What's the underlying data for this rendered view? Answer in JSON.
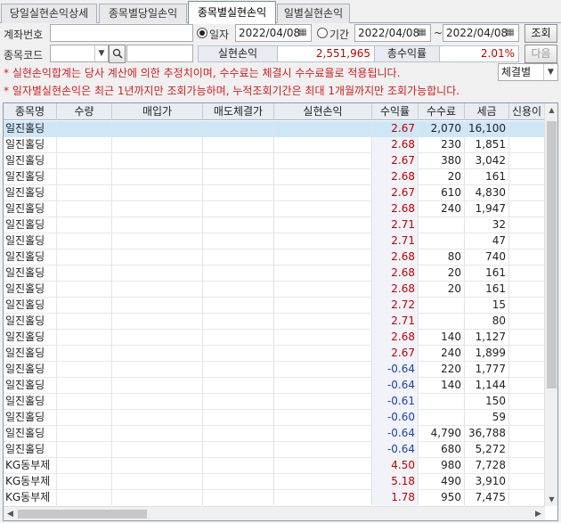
{
  "tabs": [
    "당일실현손익상세",
    "종목별당일손익",
    "종목별실현손익",
    "일별실현손익"
  ],
  "active_tab": 2,
  "form": {
    "account_label": "계좌번호",
    "code_label": "종목코드",
    "date_radio_label": "일자",
    "period_radio_label": "기간",
    "date_value": "2022/04/08",
    "period_from": "2022/04/08",
    "period_sep": "~",
    "period_to": "2022/04/08",
    "query_button": "조회",
    "next_button": "다음",
    "realized_label": "실현손익",
    "realized_value": "2,551,965",
    "total_rate_label": "총수익률",
    "total_rate_value": "2.01%",
    "group_select": "체결별"
  },
  "notes": [
    "* 실현손익합계는 당사 계산에 의한 추정치이며, 수수료는 체결시 수수료율로 적용됩니다.",
    "* 일자별실현손익은 최근 1년까지만 조회가능하며, 누적조회기간은 최대 1개월까지만 조회가능합니다."
  ],
  "columns": [
    "종목명",
    "수량",
    "매입가",
    "매도체결가",
    "실현손익",
    "수익률",
    "수수료",
    "세금",
    "신용이"
  ],
  "rows": [
    {
      "name": "일진홀딩",
      "rate": "2.67",
      "fee": "2,070",
      "tax": "16,100",
      "sign": "pos"
    },
    {
      "name": "일진홀딩",
      "rate": "2.68",
      "fee": "230",
      "tax": "1,851",
      "sign": "pos"
    },
    {
      "name": "일진홀딩",
      "rate": "2.67",
      "fee": "380",
      "tax": "3,042",
      "sign": "pos"
    },
    {
      "name": "일진홀딩",
      "rate": "2.68",
      "fee": "20",
      "tax": "161",
      "sign": "pos"
    },
    {
      "name": "일진홀딩",
      "rate": "2.67",
      "fee": "610",
      "tax": "4,830",
      "sign": "pos"
    },
    {
      "name": "일진홀딩",
      "rate": "2.68",
      "fee": "240",
      "tax": "1,947",
      "sign": "pos"
    },
    {
      "name": "일진홀딩",
      "rate": "2.71",
      "fee": "",
      "tax": "32",
      "sign": "pos"
    },
    {
      "name": "일진홀딩",
      "rate": "2.71",
      "fee": "",
      "tax": "47",
      "sign": "pos"
    },
    {
      "name": "일진홀딩",
      "rate": "2.68",
      "fee": "80",
      "tax": "740",
      "sign": "pos"
    },
    {
      "name": "일진홀딩",
      "rate": "2.68",
      "fee": "20",
      "tax": "161",
      "sign": "pos"
    },
    {
      "name": "일진홀딩",
      "rate": "2.68",
      "fee": "20",
      "tax": "161",
      "sign": "pos"
    },
    {
      "name": "일진홀딩",
      "rate": "2.72",
      "fee": "",
      "tax": "15",
      "sign": "pos"
    },
    {
      "name": "일진홀딩",
      "rate": "2.71",
      "fee": "",
      "tax": "80",
      "sign": "pos"
    },
    {
      "name": "일진홀딩",
      "rate": "2.68",
      "fee": "140",
      "tax": "1,127",
      "sign": "pos"
    },
    {
      "name": "일진홀딩",
      "rate": "2.67",
      "fee": "240",
      "tax": "1,899",
      "sign": "pos"
    },
    {
      "name": "일진홀딩",
      "rate": "-0.64",
      "fee": "220",
      "tax": "1,777",
      "sign": "neg"
    },
    {
      "name": "일진홀딩",
      "rate": "-0.64",
      "fee": "140",
      "tax": "1,144",
      "sign": "neg"
    },
    {
      "name": "일진홀딩",
      "rate": "-0.61",
      "fee": "",
      "tax": "150",
      "sign": "neg"
    },
    {
      "name": "일진홀딩",
      "rate": "-0.60",
      "fee": "",
      "tax": "59",
      "sign": "neg"
    },
    {
      "name": "일진홀딩",
      "rate": "-0.64",
      "fee": "4,790",
      "tax": "36,788",
      "sign": "neg"
    },
    {
      "name": "일진홀딩",
      "rate": "-0.64",
      "fee": "680",
      "tax": "5,272",
      "sign": "neg"
    },
    {
      "name": "KG동부제",
      "rate": "4.50",
      "fee": "980",
      "tax": "7,728",
      "sign": "pos"
    },
    {
      "name": "KG동부제",
      "rate": "5.18",
      "fee": "490",
      "tax": "3,910",
      "sign": "pos"
    },
    {
      "name": "KG동부제",
      "rate": "1.78",
      "fee": "950",
      "tax": "7,475",
      "sign": "pos"
    }
  ],
  "colors": {
    "positive": "#c00000",
    "negative": "#1f3fb0",
    "selected_row": "#cfe6f7"
  },
  "icons": {
    "calendar": "calendar-icon",
    "search": "search-icon",
    "dropdown": "chevron-down-icon"
  }
}
